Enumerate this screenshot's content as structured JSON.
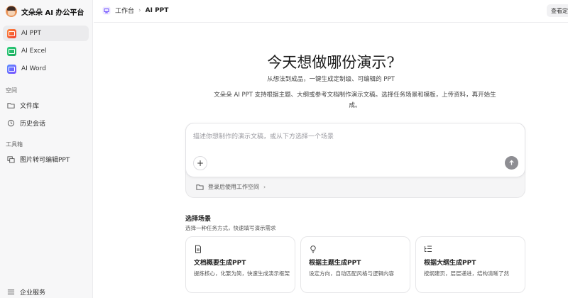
{
  "brand": {
    "name": "文朵朵 AI 办公平台"
  },
  "sidebar": {
    "apps": [
      {
        "label": "AI PPT",
        "icon": "ppt-app-icon",
        "active": true
      },
      {
        "label": "AI Excel",
        "icon": "excel-app-icon",
        "active": false
      },
      {
        "label": "AI Word",
        "icon": "word-app-icon",
        "active": false
      }
    ],
    "space_label": "空间",
    "space_items": [
      {
        "label": "文件库",
        "icon": "folder-icon"
      },
      {
        "label": "历史会话",
        "icon": "history-icon"
      }
    ],
    "tools_label": "工具箱",
    "tool_items": [
      {
        "label": "图片转可编辑PPT",
        "icon": "image-convert-icon"
      }
    ],
    "bottom_item": {
      "label": "企业服务",
      "icon": "enterprise-icon"
    }
  },
  "topbar": {
    "breadcrumb": [
      "工作台",
      "AI PPT"
    ],
    "right_button": "查看定"
  },
  "hero": {
    "title": "今天想做哪份演示?",
    "subtitle": "从想法到成品，一键生成定制级、可编辑的 PPT",
    "description": "文朵朵 AI PPT 支持根据主题、大纲或参考文档制作演示文稿。选择任务场景和模板，上传资料，再开始生成。"
  },
  "composer": {
    "placeholder": "描述你想制作的演示文稿，或从下方选择一个场景",
    "login_hint": "登录后使用工作空间"
  },
  "scenes": {
    "title": "选择场景",
    "subtitle": "选择一种任务方式，快速填写演示需求",
    "cards": [
      {
        "title": "文档概要生成PPT",
        "desc": "提炼核心，化繁为简，快速生成演示框架",
        "icon": "document-icon"
      },
      {
        "title": "根据主题生成PPT",
        "desc": "设定方向，自动匹配风格与逻辑内容",
        "icon": "lightbulb-icon"
      },
      {
        "title": "根据大纲生成PPT",
        "desc": "按纲建页，层层递进，结构清晰了然",
        "icon": "outline-list-icon"
      }
    ]
  }
}
